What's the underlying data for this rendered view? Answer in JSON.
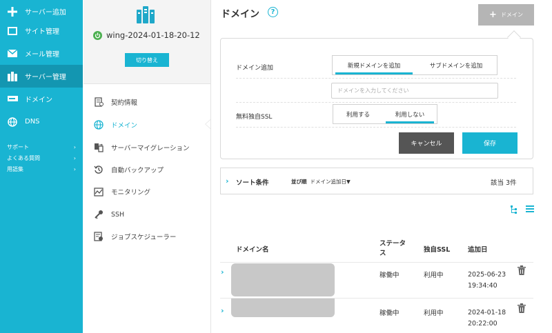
{
  "nav": {
    "items": [
      {
        "label": "サーバー追加",
        "icon": "plus-icon"
      },
      {
        "label": "サイト管理",
        "icon": "window-icon"
      },
      {
        "label": "メール管理",
        "icon": "mail-icon"
      },
      {
        "label": "サーバー管理",
        "icon": "server-icon"
      },
      {
        "label": "ドメイン",
        "icon": "domain-card-icon"
      },
      {
        "label": "DNS",
        "icon": "globe-icon"
      }
    ],
    "sub": [
      {
        "label": "サポート",
        "arrow": "›"
      },
      {
        "label": "よくある質問",
        "arrow": "›"
      },
      {
        "label": "用語集",
        "arrow": "›"
      }
    ]
  },
  "server": {
    "name": "wing-2024-01-18-20-12",
    "switch_label": "切り替え",
    "menu": [
      {
        "label": "契約情報",
        "icon": "contract-icon"
      },
      {
        "label": "ドメイン",
        "icon": "globe-icon"
      },
      {
        "label": "サーバーマイグレーション",
        "icon": "migration-icon"
      },
      {
        "label": "自動バックアップ",
        "icon": "backup-icon"
      },
      {
        "label": "モニタリング",
        "icon": "monitoring-icon"
      },
      {
        "label": "SSH",
        "icon": "key-icon"
      },
      {
        "label": "ジョブスケジューラー",
        "icon": "scheduler-icon"
      }
    ]
  },
  "main": {
    "title": "ドメイン",
    "help": "?",
    "add_button": "ドメイン",
    "form": {
      "add_label": "ドメイン追加",
      "new_domain": "新規ドメインを追加",
      "sub_domain": "サブドメインを追加",
      "input_placeholder": "ドメインを入力してください",
      "ssl_label": "無料独自SSL",
      "ssl_on": "利用する",
      "ssl_off": "利用しない",
      "cancel": "キャンセル",
      "save": "保存"
    },
    "sort": {
      "chevron": "›",
      "title": "ソート条件",
      "order_key": "並び順",
      "order_value": "ドメイン追加日▼",
      "count": "該当 3件"
    },
    "table": {
      "headers": {
        "domain": "ドメイン名",
        "status_line1": "ステータ",
        "status_line2": "ス",
        "ssl": "独自SSL",
        "date": "追加日"
      },
      "rows": [
        {
          "status": "稼働中",
          "ssl": "利用中",
          "date": "2025-06-23",
          "time": "19:34:40"
        },
        {
          "status": "稼働中",
          "ssl": "利用中",
          "date": "2024-01-18",
          "time": "20:22:00"
        }
      ]
    }
  },
  "colors": {
    "accent": "#19b4d2",
    "nav_active": "#1396b1",
    "disabled_button": "#b5b5b5",
    "cancel_button": "#555555",
    "status_green": "#4caf50"
  }
}
